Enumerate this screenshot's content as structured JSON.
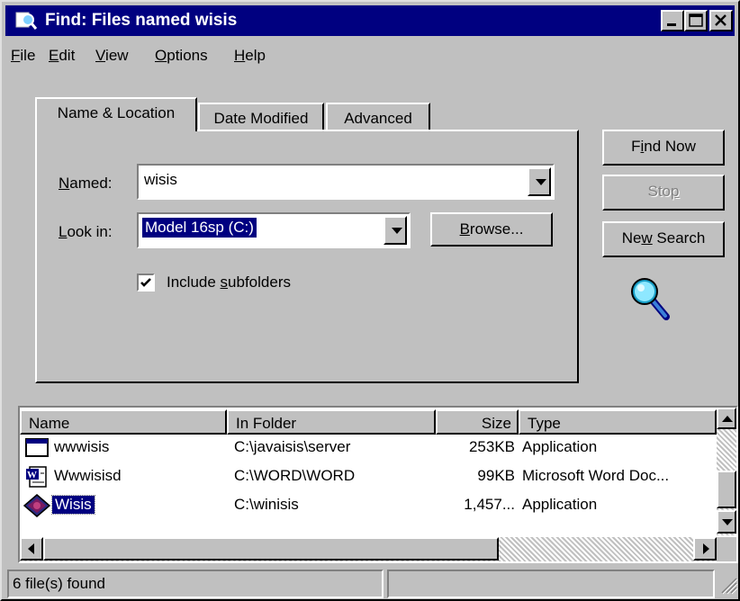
{
  "window": {
    "title": "Find: Files named wisis",
    "colors": {
      "titlebar": "#000080",
      "face": "#c0c0c0",
      "selection": "#000080"
    }
  },
  "menu": [
    {
      "label": "File",
      "key": "F",
      "rest": "ile"
    },
    {
      "label": "Edit",
      "key": "E",
      "rest": "dit"
    },
    {
      "label": "View",
      "key": "V",
      "rest": "iew"
    },
    {
      "label": "Options",
      "key": "O",
      "rest": "ptions"
    },
    {
      "label": "Help",
      "key": "H",
      "rest": "elp"
    }
  ],
  "tabs": [
    {
      "label": "Name & Location",
      "active": true
    },
    {
      "label": "Date Modified",
      "active": false
    },
    {
      "label": "Advanced",
      "active": false
    }
  ],
  "form": {
    "named_label_key": "N",
    "named_label_rest": "amed:",
    "named_value": "wisis",
    "lookin_label_key": "L",
    "lookin_label_rest": "ook in:",
    "lookin_value": "Model 16sp (C:)",
    "browse_key": "B",
    "browse_rest": "rowse...",
    "include_pre": "Include ",
    "include_key": "s",
    "include_rest": "ubfolders",
    "include_checked": true
  },
  "buttons": {
    "find_pre": "F",
    "find_key": "i",
    "find_rest": "nd Now",
    "stop_pre": "Sto",
    "stop_key": "p",
    "stop_enabled": false,
    "new_pre": "Ne",
    "new_key": "w",
    "new_rest": " Search"
  },
  "results": {
    "columns": [
      "Name",
      "In Folder",
      "Size",
      "Type"
    ],
    "rows": [
      {
        "name": "wwwisis",
        "folder": "C:\\javaisis\\server",
        "size": "253KB",
        "type": "Application",
        "icon": "application-window-icon",
        "selected": false
      },
      {
        "name": "Wwwisisd",
        "folder": "C:\\WORD\\WORD",
        "size": "99KB",
        "type": "Microsoft Word Doc...",
        "icon": "word-document-icon",
        "selected": false
      },
      {
        "name": "Wisis",
        "folder": "C:\\winisis",
        "size": "1,457...",
        "type": "Application",
        "icon": "winisis-app-icon",
        "selected": true
      }
    ]
  },
  "status": {
    "text": "6 file(s) found"
  }
}
